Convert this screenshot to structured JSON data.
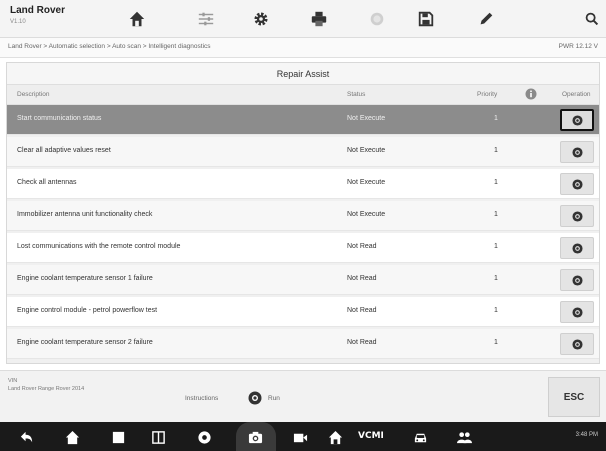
{
  "header": {
    "brand_title": "Land Rover",
    "brand_sub": "V1.10",
    "toolbar_icons": [
      "home-icon",
      "settings-sliders-icon",
      "gear-icon",
      "print-icon",
      "capture-icon",
      "save-icon",
      "edit-icon",
      "search-icon"
    ]
  },
  "breadcrumb": {
    "path": "Land Rover > Automatic selection > Auto scan > Intelligent diagnostics",
    "right": "PWR 12.12 V"
  },
  "panel": {
    "title": "Repair Assist",
    "columns": {
      "description": "Description",
      "status": "Status",
      "priority": "Priority",
      "operation": "Operation"
    }
  },
  "rows": [
    {
      "description": "Start communication status",
      "status": "Not Execute",
      "priority": "1",
      "selected": true
    },
    {
      "description": "Clear all adaptive values reset",
      "status": "Not Execute",
      "priority": "1"
    },
    {
      "description": "Check all antennas",
      "status": "Not Execute",
      "priority": "1"
    },
    {
      "description": "Immobilizer antenna unit functionality check",
      "status": "Not Execute",
      "priority": "1"
    },
    {
      "description": "Lost communications with the remote control module",
      "status": "Not Read",
      "priority": "1"
    },
    {
      "description": "Engine coolant temperature sensor 1 failure",
      "status": "Not Read",
      "priority": "1"
    },
    {
      "description": "Engine control module - petrol powerflow test",
      "status": "Not Read",
      "priority": "1"
    },
    {
      "description": "Engine coolant temperature sensor 2 failure",
      "status": "Not Read",
      "priority": "1"
    }
  ],
  "footer": {
    "info_line1": "VIN",
    "info_line2": "Land Rover Range Rover 2014",
    "instruction_label": "Instructions",
    "run_label": "Run",
    "esc_label": "ESC"
  },
  "navbar": {
    "vcmi_label": "VCMI",
    "clock": "3:48 PM"
  },
  "colors": {
    "selected_row": "#8c8c8c",
    "navbar": "#1a1a1a"
  }
}
